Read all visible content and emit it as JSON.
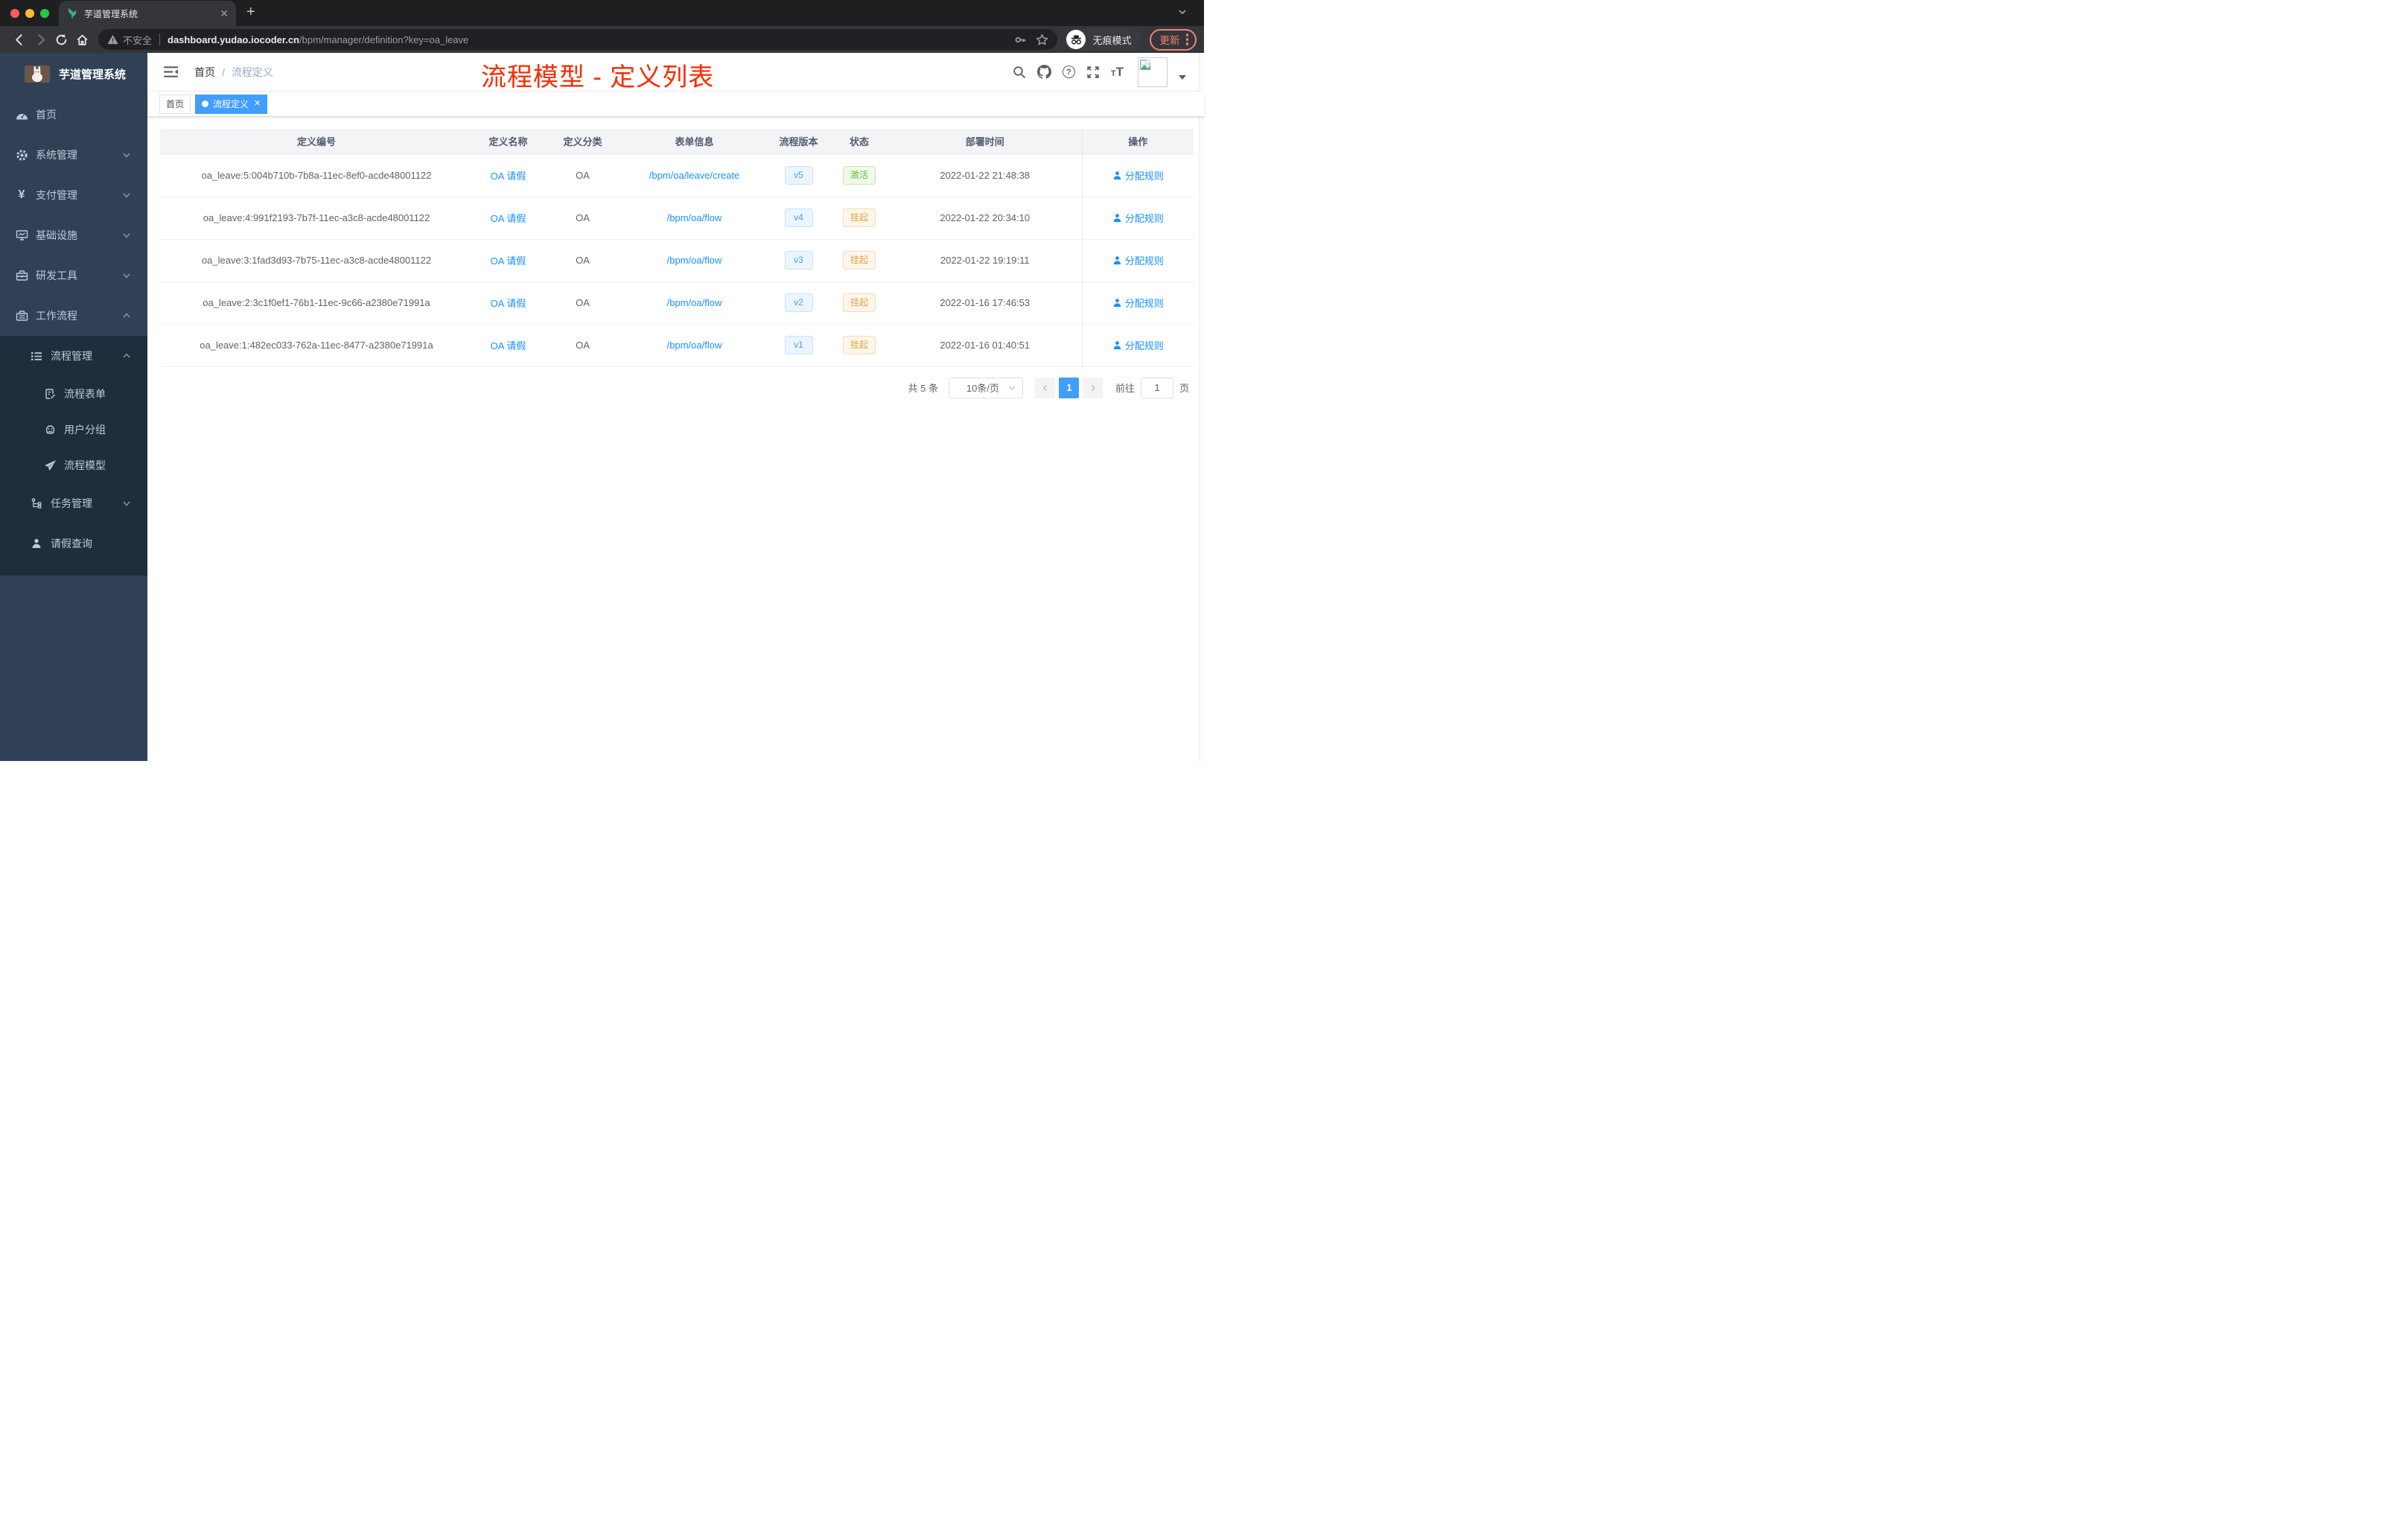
{
  "browser": {
    "tab_title": "芋道管理系统",
    "security_label": "不安全",
    "url_domain": "dashboard.yudao.iocoder.cn",
    "url_path": "/bpm/manager/definition?key=oa_leave",
    "incognito_label": "无痕模式",
    "update_label": "更新"
  },
  "sidebar": {
    "logo_title": "芋道管理系统",
    "items": [
      {
        "label": "首页",
        "icon": "dashboard-icon"
      },
      {
        "label": "系统管理",
        "icon": "gear-icon",
        "chevron": "down"
      },
      {
        "label": "支付管理",
        "icon": "yen-icon",
        "chevron": "down"
      },
      {
        "label": "基础设施",
        "icon": "monitor-icon",
        "chevron": "down"
      },
      {
        "label": "研发工具",
        "icon": "toolbox-icon",
        "chevron": "down"
      },
      {
        "label": "工作流程",
        "icon": "briefcase-icon",
        "chevron": "up"
      },
      {
        "label": "流程管理",
        "icon": "list-icon",
        "chevron": "up"
      },
      {
        "label": "流程表单",
        "icon": "form-icon"
      },
      {
        "label": "用户分组",
        "icon": "people-icon"
      },
      {
        "label": "流程模型",
        "icon": "send-icon"
      },
      {
        "label": "任务管理",
        "icon": "tree-icon",
        "chevron": "down"
      },
      {
        "label": "请假查询",
        "icon": "user-icon"
      }
    ]
  },
  "header": {
    "breadcrumb_home": "首页",
    "breadcrumb_separator": "/",
    "breadcrumb_current": "流程定义",
    "annotation": "流程模型 - 定义列表"
  },
  "tags": {
    "home": "首页",
    "active": "流程定义"
  },
  "table": {
    "columns": [
      "定义编号",
      "定义名称",
      "定义分类",
      "表单信息",
      "流程版本",
      "状态",
      "部署时间",
      "操作"
    ],
    "rows": [
      {
        "id": "oa_leave:5:004b710b-7b8a-11ec-8ef0-acde48001122",
        "name": "OA 请假",
        "category": "OA",
        "form": "/bpm/oa/leave/create",
        "version": "v5",
        "status": "激活",
        "status_type": "success",
        "time": "2022-01-22 21:48:38",
        "action": "分配规则"
      },
      {
        "id": "oa_leave:4:991f2193-7b7f-11ec-a3c8-acde48001122",
        "name": "OA 请假",
        "category": "OA",
        "form": "/bpm/oa/flow",
        "version": "v4",
        "status": "挂起",
        "status_type": "warning",
        "time": "2022-01-22 20:34:10",
        "action": "分配规则"
      },
      {
        "id": "oa_leave:3:1fad3d93-7b75-11ec-a3c8-acde48001122",
        "name": "OA 请假",
        "category": "OA",
        "form": "/bpm/oa/flow",
        "version": "v3",
        "status": "挂起",
        "status_type": "warning",
        "time": "2022-01-22 19:19:11",
        "action": "分配规则"
      },
      {
        "id": "oa_leave:2:3c1f0ef1-76b1-11ec-9c66-a2380e71991a",
        "name": "OA 请假",
        "category": "OA",
        "form": "/bpm/oa/flow",
        "version": "v2",
        "status": "挂起",
        "status_type": "warning",
        "time": "2022-01-16 17:46:53",
        "action": "分配规则"
      },
      {
        "id": "oa_leave:1:482ec033-762a-11ec-8477-a2380e71991a",
        "name": "OA 请假",
        "category": "OA",
        "form": "/bpm/oa/flow",
        "version": "v1",
        "status": "挂起",
        "status_type": "warning",
        "time": "2022-01-16 01:40:51",
        "action": "分配规则"
      }
    ]
  },
  "pagination": {
    "total": "共 5 条",
    "page_size": "10条/页",
    "page": "1",
    "goto_label": "前往",
    "goto_value": "1",
    "goto_unit": "页"
  },
  "colors": {
    "primary": "#409eff",
    "link": "#1890ff",
    "success": "#67c23a",
    "warning": "#e6a23c",
    "annotation_red": "#fb2b00",
    "sidebar_bg": "#304156",
    "sidebar_submenu_bg": "#1f2d3d",
    "update_pill": "#ee8277"
  }
}
